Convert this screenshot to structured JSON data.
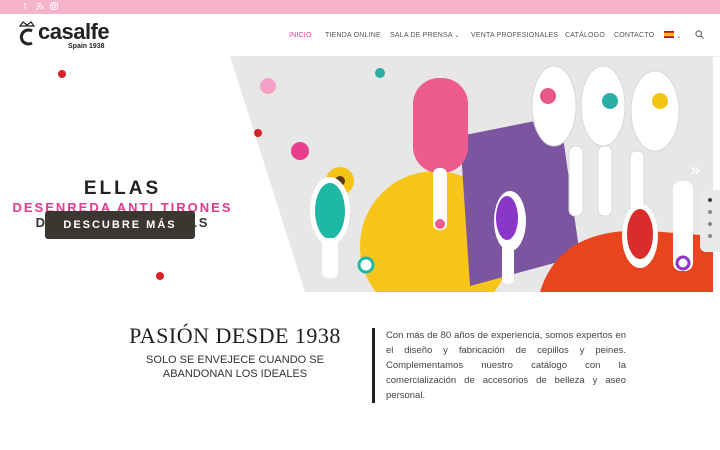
{
  "topbar": {
    "social_icons": [
      "facebook-icon",
      "rss-icon",
      "instagram-icon"
    ]
  },
  "header": {
    "logo_text": "casalfe",
    "logo_tagline": "Spain 1938",
    "nav": [
      {
        "label": "INICIO",
        "active": true
      },
      {
        "label": "TIENDA ONLINE",
        "active": false
      },
      {
        "label": "SALA DE PRENSA",
        "active": false,
        "dropdown": true
      },
      {
        "label": "VENTA PROFESIONALES",
        "active": false
      },
      {
        "label": "CATÁLOGO",
        "active": false
      },
      {
        "label": "CONTACTO",
        "active": false
      }
    ],
    "language_flag": "spain-flag-icon"
  },
  "hero": {
    "title": "ELLAS",
    "subtitle_es": "DESENREDA ANTI TIRONES",
    "subtitle_en": "DETANGLE NO PULLS",
    "cta_label": "DESCUBRE MÁS",
    "slides_total": 4,
    "slide_active": 1
  },
  "about": {
    "heading": "PASIÓN DESDE 1938",
    "tagline": "SOLO SE ENVEJECE CUANDO SE ABANDONAN LOS IDEALES",
    "paragraph": "Con más de 80 años de experiencia, somos expertos en el diseño y fabricación de cepillos y peines. Complementamos nuestro catálogo con la comercialización de accesorios de belleza y aseo personal."
  },
  "colors": {
    "accent": "#e5398d",
    "topbar": "#f6b3cc",
    "button": "#3c3630"
  }
}
